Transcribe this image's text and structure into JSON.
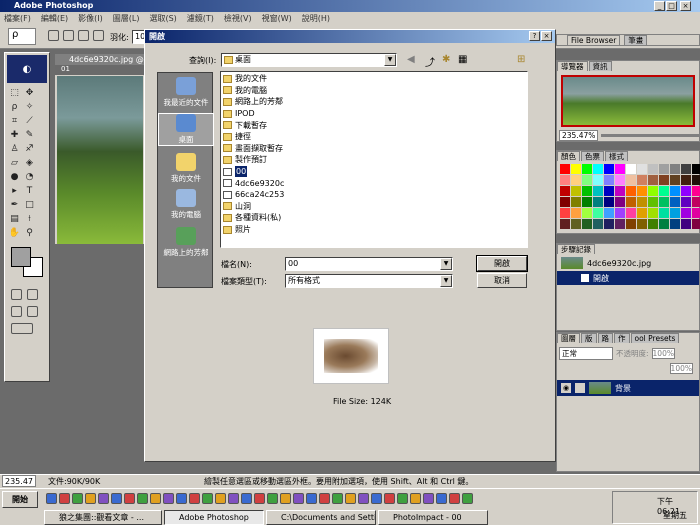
{
  "app": {
    "title": "Adobe Photoshop"
  },
  "menu": [
    "檔案(F)",
    "編輯(E)",
    "影像(I)",
    "圖層(L)",
    "選取(S)",
    "濾鏡(T)",
    "檢視(V)",
    "視窗(W)",
    "說明(H)"
  ],
  "options": {
    "feather_label": "羽化:",
    "feather_value": "10"
  },
  "doc": {
    "title": "4dc6e9320c.jpg @",
    "sub": "01"
  },
  "dialog": {
    "title": "開啟",
    "lookin_label": "查詢(I):",
    "lookin_value": "桌面",
    "places": [
      "我最近的文件",
      "桌面",
      "我的文件",
      "我的電腦",
      "網路上的芳鄰"
    ],
    "files": [
      {
        "name": "我的文件",
        "kind": "folder"
      },
      {
        "name": "我的電腦",
        "kind": "folder"
      },
      {
        "name": "網路上的芳鄰",
        "kind": "folder"
      },
      {
        "name": "IPOD",
        "kind": "folder"
      },
      {
        "name": "下載暫存",
        "kind": "folder"
      },
      {
        "name": "捷徑",
        "kind": "folder"
      },
      {
        "name": "畫面擷取暫存",
        "kind": "folder"
      },
      {
        "name": "製作預訂",
        "kind": "folder"
      },
      {
        "name": "00",
        "kind": "file"
      },
      {
        "name": "4dc6e9320c",
        "kind": "file"
      },
      {
        "name": "66ca24c253",
        "kind": "file"
      },
      {
        "name": "山洞",
        "kind": "folder"
      },
      {
        "name": "各種資料(私)",
        "kind": "folder"
      },
      {
        "name": "照片",
        "kind": "folder"
      }
    ],
    "filename_label": "檔名(N):",
    "filename_value": "00",
    "filetype_label": "檔案類型(T):",
    "filetype_value": "所有格式",
    "open_button": "開啟",
    "cancel_button": "取消",
    "filesize": "File Size: 124K"
  },
  "right": {
    "filebrowser_tab": "File Browser",
    "brush_tab": "筆畫",
    "nav_tabs": [
      "導覽器",
      "資訊"
    ],
    "zoom": "235.47%",
    "color_tabs": [
      "顏色",
      "色票",
      "樣式"
    ],
    "history_tab": "步驟記錄",
    "history_doc": "4dc6e9320c.jpg",
    "history_item": "開啟",
    "layer_tabs": [
      "圖層",
      "版",
      "路",
      "作",
      "ool Presets"
    ],
    "blend_mode": "正常",
    "opacity_label": "不透明度:",
    "opacity_value": "100%",
    "fill_value": "100%",
    "layer_name": "背景"
  },
  "status": {
    "zoom": "235.47",
    "doc": "文件:90K/90K",
    "hint": "繪製任意選區或移動選區外框。要用附加選項，使用 Shift、Alt 和 Ctrl 鍵。"
  },
  "taskbar": {
    "start": "開始",
    "tasks": [
      "狼之集團::觀看文章 - ...",
      "Adobe Photoshop",
      "C:\\Documents and Setting...",
      "PhotoImpact - 00"
    ],
    "time": "下午 06:21",
    "day": "星期五"
  },
  "swatch_colors": [
    "#ff0000",
    "#ffff00",
    "#00ff00",
    "#00ffff",
    "#0000ff",
    "#ff00ff",
    "#ffffff",
    "#e0e0e0",
    "#c0c0c0",
    "#a0a0a0",
    "#808080",
    "#404040",
    "#000000",
    "#ff8080",
    "#ffd080",
    "#80ff80",
    "#80ffff",
    "#8080ff",
    "#ff80ff",
    "#f0c0a0",
    "#d08060",
    "#a06040",
    "#804020",
    "#604020",
    "#402010",
    "#201008",
    "#c00000",
    "#c0c000",
    "#00c000",
    "#00c0c0",
    "#0000c0",
    "#c000c0",
    "#ff6000",
    "#ff9000",
    "#90ff00",
    "#00ff90",
    "#0090ff",
    "#9000ff",
    "#ff0090",
    "#800000",
    "#808000",
    "#008000",
    "#008080",
    "#000080",
    "#800080",
    "#c06000",
    "#c09000",
    "#60c000",
    "#00c060",
    "#0060c0",
    "#6000c0",
    "#c00060",
    "#ff4040",
    "#ffa040",
    "#a0ff40",
    "#40ffa0",
    "#40a0ff",
    "#a040ff",
    "#ff40a0",
    "#e0a000",
    "#a0e000",
    "#00e0a0",
    "#00a0e0",
    "#a000e0",
    "#e000a0",
    "#602020",
    "#606020",
    "#206020",
    "#206060",
    "#202060",
    "#602060",
    "#804000",
    "#806000",
    "#408000",
    "#008040",
    "#004080",
    "#400080",
    "#800040"
  ]
}
